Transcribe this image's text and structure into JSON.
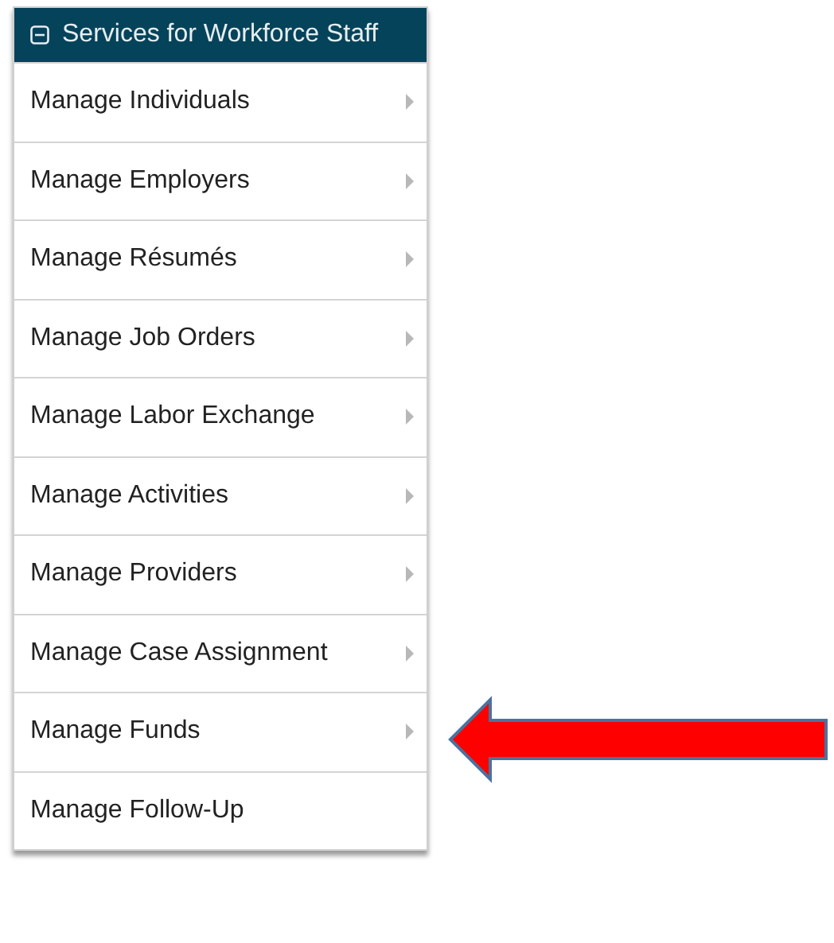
{
  "menu": {
    "title": "Services for Workforce Staff",
    "expanded": true,
    "items": [
      {
        "label": "Manage Individuals",
        "has_submenu": true
      },
      {
        "label": "Manage Employers",
        "has_submenu": true
      },
      {
        "label": "Manage Résumés",
        "has_submenu": true
      },
      {
        "label": "Manage Job Orders",
        "has_submenu": true
      },
      {
        "label": "Manage Labor Exchange",
        "has_submenu": true
      },
      {
        "label": "Manage Activities",
        "has_submenu": true
      },
      {
        "label": "Manage Providers",
        "has_submenu": true
      },
      {
        "label": "Manage Case Assignment",
        "has_submenu": true
      },
      {
        "label": "Manage Funds",
        "has_submenu": true
      },
      {
        "label": "Manage Follow-Up",
        "has_submenu": false
      }
    ]
  }
}
